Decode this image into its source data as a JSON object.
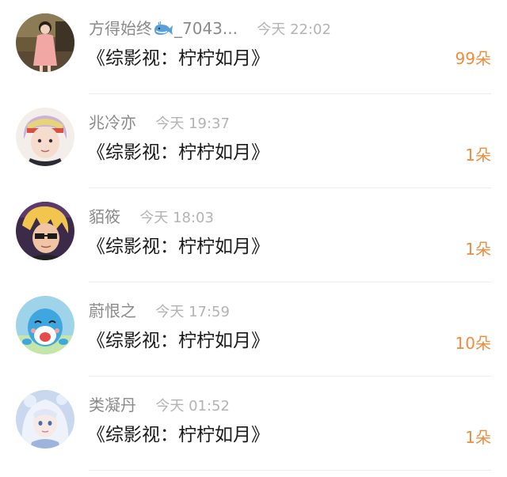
{
  "rows": [
    {
      "username": "方得始终",
      "username_suffix": "_7043...",
      "username_icon": "whale-emoji-icon",
      "time": "今天 22:02",
      "title": "《综影视：柠柠如月》",
      "count": "99朵",
      "avatar": "girl-in-pink-dress-avatar"
    },
    {
      "username": "兆冷亦",
      "time": "今天 19:37",
      "title": "《综影视：柠柠如月》",
      "count": "1朵",
      "avatar": "anime-boy-avatar"
    },
    {
      "username": "貊筱",
      "time": "今天 18:03",
      "title": "《综影视：柠柠如月》",
      "count": "1朵",
      "avatar": "blonde-character-avatar"
    },
    {
      "username": "蔚恨之",
      "time": "今天 17:59",
      "title": "《综影视：柠柠如月》",
      "count": "10朵",
      "avatar": "blue-cartoon-avatar"
    },
    {
      "username": "类凝丹",
      "time": "今天 01:52",
      "title": "《综影视：柠柠如月》",
      "count": "1朵",
      "avatar": "white-hair-anime-avatar"
    }
  ],
  "colors": {
    "accent": "#f08b3b",
    "username": "#8a8a8a",
    "time": "#b3b3b3",
    "title": "#1a1a1a"
  }
}
